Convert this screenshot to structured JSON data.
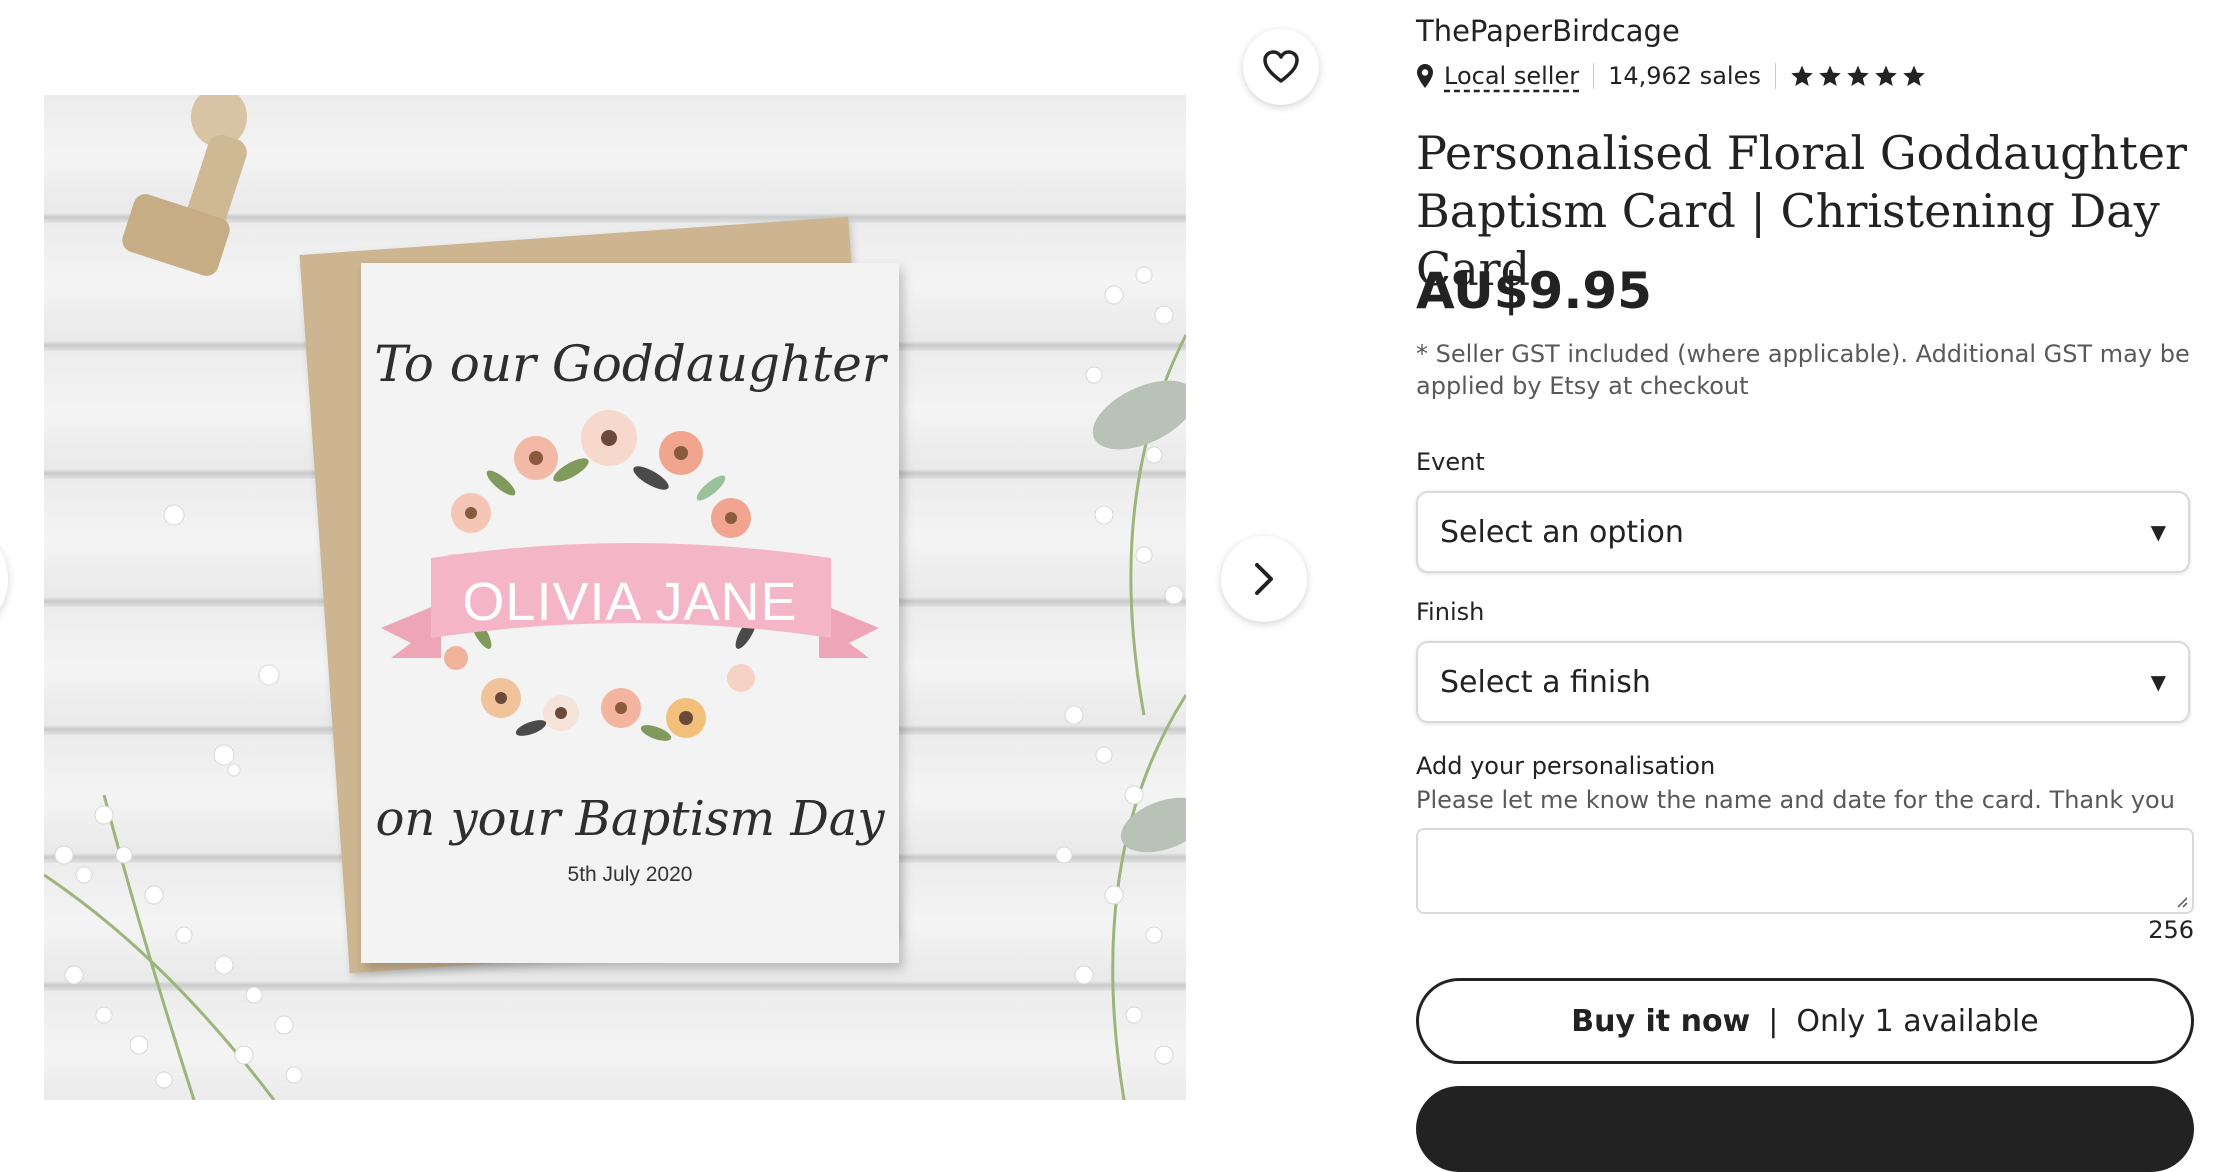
{
  "gallery": {
    "card_line1": "To our Goddaughter",
    "card_name": "OLIVIA JANE",
    "card_line3": "on your Baptism Day",
    "card_date": "5th July 2020",
    "next_icon": "chevron-right-icon",
    "favorite_icon": "heart-icon"
  },
  "shop": {
    "name": "ThePaperBirdcage",
    "location_icon": "map-pin-icon",
    "local_seller": "Local seller",
    "sales": "14,962 sales",
    "rating_stars": 5
  },
  "listing": {
    "title": "Personalised Floral Goddaughter Baptism Card | Christening Day Card",
    "price": "AU$9.95",
    "tax_note": "* Seller GST included (where applicable). Additional GST may be applied by Etsy at checkout"
  },
  "options": {
    "event_label": "Event",
    "event_value": "Select an option",
    "finish_label": "Finish",
    "finish_value": "Select a finish",
    "caret_icon": "caret-down-icon"
  },
  "personalisation": {
    "label": "Add your personalisation",
    "helper": "Please let me know the name and date for the card. Thank you",
    "value": "",
    "counter": "256"
  },
  "actions": {
    "buy_now": "Buy it now",
    "separator": "|",
    "availability": "Only 1 available"
  },
  "colors": {
    "text": "#222222",
    "muted": "#595959",
    "border": "#d9d9d9",
    "banner_pink": "#f4b6c6"
  }
}
